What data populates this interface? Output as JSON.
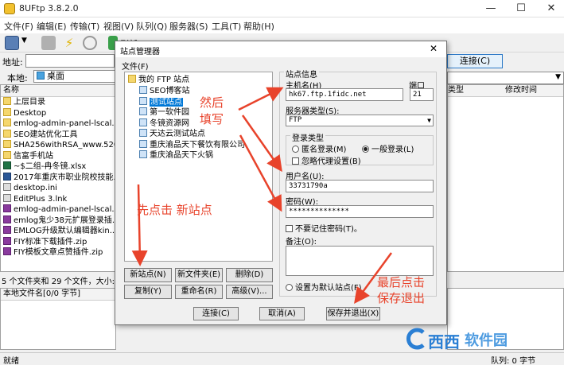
{
  "window": {
    "title": "8UFtp 3.8.2.0",
    "min": "—",
    "max": "☐",
    "close": "✕"
  },
  "menu": [
    "文件(F)",
    "编辑(E)",
    "传输(T)",
    "视图(V)",
    "队列(Q)",
    "服务器(S)",
    "工具(T)",
    "帮助(H)"
  ],
  "toolbar": {
    "refresh_label": "刷新"
  },
  "address": {
    "label": "地址:",
    "value": "",
    "connect_label": "连接(C)"
  },
  "local": {
    "label": "本地:",
    "path": "桌面",
    "col_name": "名称",
    "files": [
      {
        "name": "上层目录",
        "icon": "folder"
      },
      {
        "name": "Desktop",
        "icon": "folder"
      },
      {
        "name": "emlog-admin-panel-lscal...",
        "icon": "folder"
      },
      {
        "name": "SEO建站优化工具",
        "icon": "folder"
      },
      {
        "name": "SHA256withRSA_www.520...",
        "icon": "folder"
      },
      {
        "name": "信富手机站",
        "icon": "folder"
      },
      {
        "name": "~$二组-冉冬镜.xlsx",
        "icon": "excel"
      },
      {
        "name": "2017年重庆市职业院校技能...",
        "icon": "word"
      },
      {
        "name": "desktop.ini",
        "icon": "ini"
      },
      {
        "name": "EditPlus 3.lnk",
        "icon": "ini"
      },
      {
        "name": "emlog-admin-panel-lscal...",
        "icon": "zip"
      },
      {
        "name": "emlog鬼少38元扩展登录插...",
        "icon": "zip"
      },
      {
        "name": "EMLOG升级默认编辑器kin...",
        "icon": "zip"
      },
      {
        "name": "FIY标准下载插件.zip",
        "icon": "zip"
      },
      {
        "name": "FIY模板文章点赞插件.zip",
        "icon": "zip"
      }
    ],
    "summary": "5 个文件夹和 29 个文件，大小:",
    "queue_header": "本地文件名[0/0 字节]"
  },
  "remote": {
    "col_type": "类型",
    "col_modified": "修改时间"
  },
  "status": {
    "left": "就绪",
    "right": "队列: 0 字节"
  },
  "dialog": {
    "title": "站点管理器",
    "close": "✕",
    "menu_file": "文件(F)",
    "tree_root": "我的 FTP 站点",
    "sites": [
      "SEO博客站",
      "测试站点",
      "第一软件园",
      "冬镜资源网",
      "天达云测试站点",
      "重庆渝品天下餐饮有限公司",
      "重庆渝品天下火锅"
    ],
    "selected_site": "测试站点",
    "site_info_label": "站点信息",
    "host_label": "主机名(H)",
    "host_value": "hk67.ftp.1fidc.net",
    "port_label": "端口",
    "port_value": "21",
    "server_type_label": "服务器类型(S):",
    "server_type_value": "FTP",
    "login_type_label": "登录类型",
    "anon_label": "匿名登录(M)",
    "normal_label": "一般登录(L)",
    "ignore_proxy_label": "忽略代理设置(B)",
    "user_label": "用户名(U):",
    "user_value": "33731790a",
    "pass_label": "密码(W):",
    "pass_value": "**************",
    "remember_label": "不要记住密码(T)。",
    "note_label": "备注(O):",
    "note_value": "",
    "default_label": "设置为默认站点(F)",
    "buttons": {
      "new_site": "新站点(N)",
      "new_folder": "新文件夹(E)",
      "delete": "删除(D)",
      "copy": "复制(Y)",
      "rename": "重命名(R)",
      "advanced": "高级(V)...",
      "connect": "连接(C)",
      "cancel": "取消(A)",
      "save_exit": "保存并退出(X)"
    }
  },
  "annotations": {
    "fill_1": "然后",
    "fill_2": "填写",
    "first": "先点击  新站点",
    "last_1": "最后点击",
    "last_2": "保存退出"
  },
  "watermark": {
    "text1": "西西",
    "text2": "软件园",
    "text3": "CR173.COM"
  }
}
